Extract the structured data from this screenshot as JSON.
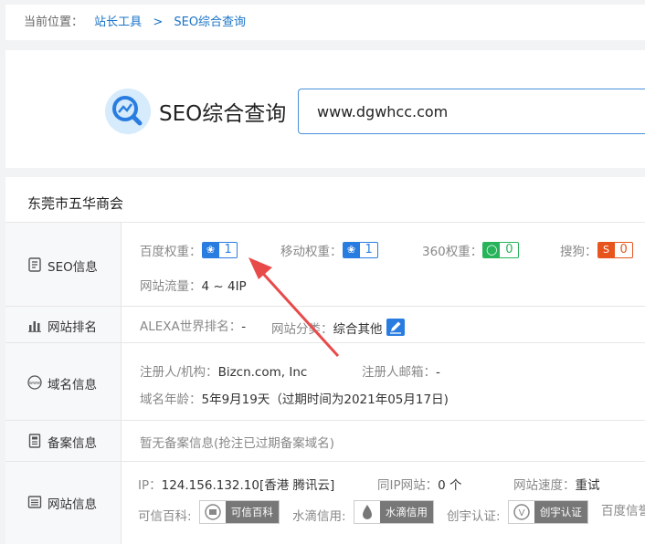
{
  "breadcrumb": {
    "prefix": "当前位置：",
    "items": [
      "站长工具",
      "SEO综合查询"
    ],
    "separator": ">"
  },
  "header": {
    "title": "SEO综合查询",
    "search_value": "www.dgwhcc.com"
  },
  "site_name": "东莞市五华商会",
  "seo": {
    "label": "SEO信息",
    "baidu_label": "百度权重：",
    "baidu_value": "1",
    "mobile_label": "移动权重：",
    "mobile_value": "1",
    "so360_label": "360权重：",
    "so360_value": "0",
    "sogou_label": "搜狗：",
    "sogou_value": "0",
    "traffic_label": "网站流量：",
    "traffic_value": "4 ~ 4IP"
  },
  "rank": {
    "label": "网站排名",
    "alexa_label": "ALEXA世界排名：",
    "alexa_value": "-",
    "category_label": "网站分类：",
    "category_value": "综合其他"
  },
  "domain": {
    "label": "域名信息",
    "registrant_label": "注册人/机构：",
    "registrant_value": "Bizcn.com, Inc",
    "email_label": "注册人邮箱：",
    "email_value": "-",
    "age_label": "域名年龄：",
    "age_value": "5年9月19天（过期时间为2021年05月17日)"
  },
  "icp": {
    "label": "备案信息",
    "value": "暂无备案信息(抢注已过期备案域名)"
  },
  "site": {
    "label": "网站信息",
    "ip_label": "IP：",
    "ip_value": "124.156.132.10[香港 腾讯云]",
    "same_ip_label": "同IP网站：",
    "same_ip_value": "0 个",
    "speed_label": "网站速度：",
    "speed_value": "重试",
    "kexin_label": "可信百科:",
    "kexin_badge": "可信百科",
    "shuidi_label": "水滴信用:",
    "shuidi_badge": "水滴信用",
    "chuangyu_label": "创宇认证:",
    "chuangyu_badge": "创宇认证",
    "baidu_trust_label": "百度信誉"
  },
  "colors": {
    "accent": "#1a73c7",
    "badge_blue": "#2a7de0",
    "badge_green": "#27b35a",
    "badge_orange": "#e8541e",
    "arrow": "#e84a4a"
  }
}
